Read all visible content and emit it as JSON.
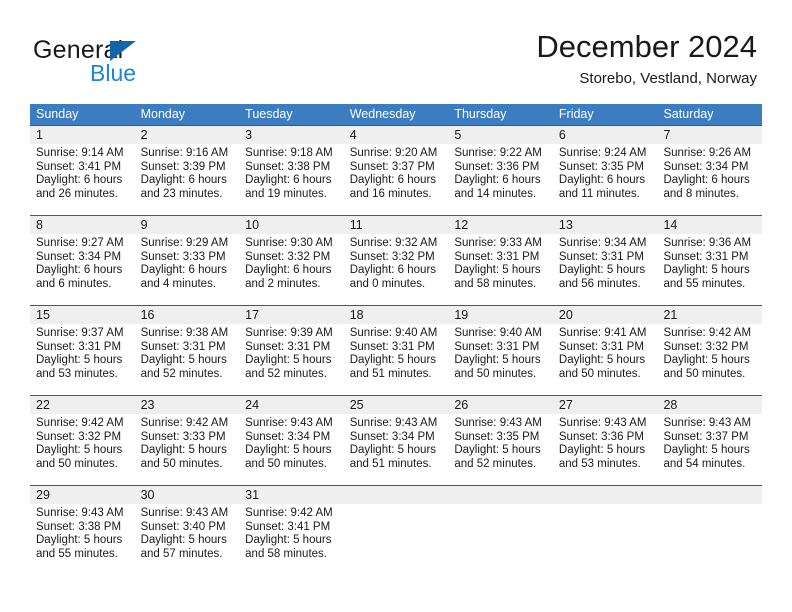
{
  "brand": {
    "name_part1": "General",
    "name_part2": "Blue",
    "logo_icon": "triangle-icon",
    "accent_color": "#1d86d8",
    "triangle_color": "#1165ad"
  },
  "header": {
    "month_title": "December 2024",
    "location": "Storebo, Vestland, Norway"
  },
  "theme": {
    "header_row_color": "#3b7dc0",
    "date_band_color": "#efefef",
    "week_divider_color": "#1f5fa8"
  },
  "weekdays": [
    "Sunday",
    "Monday",
    "Tuesday",
    "Wednesday",
    "Thursday",
    "Friday",
    "Saturday"
  ],
  "weeks": [
    {
      "days": [
        {
          "num": "1",
          "sunrise": "Sunrise: 9:14 AM",
          "sunset": "Sunset: 3:41 PM",
          "daylight1": "Daylight: 6 hours",
          "daylight2": "and 26 minutes."
        },
        {
          "num": "2",
          "sunrise": "Sunrise: 9:16 AM",
          "sunset": "Sunset: 3:39 PM",
          "daylight1": "Daylight: 6 hours",
          "daylight2": "and 23 minutes."
        },
        {
          "num": "3",
          "sunrise": "Sunrise: 9:18 AM",
          "sunset": "Sunset: 3:38 PM",
          "daylight1": "Daylight: 6 hours",
          "daylight2": "and 19 minutes."
        },
        {
          "num": "4",
          "sunrise": "Sunrise: 9:20 AM",
          "sunset": "Sunset: 3:37 PM",
          "daylight1": "Daylight: 6 hours",
          "daylight2": "and 16 minutes."
        },
        {
          "num": "5",
          "sunrise": "Sunrise: 9:22 AM",
          "sunset": "Sunset: 3:36 PM",
          "daylight1": "Daylight: 6 hours",
          "daylight2": "and 14 minutes."
        },
        {
          "num": "6",
          "sunrise": "Sunrise: 9:24 AM",
          "sunset": "Sunset: 3:35 PM",
          "daylight1": "Daylight: 6 hours",
          "daylight2": "and 11 minutes."
        },
        {
          "num": "7",
          "sunrise": "Sunrise: 9:26 AM",
          "sunset": "Sunset: 3:34 PM",
          "daylight1": "Daylight: 6 hours",
          "daylight2": "and 8 minutes."
        }
      ]
    },
    {
      "days": [
        {
          "num": "8",
          "sunrise": "Sunrise: 9:27 AM",
          "sunset": "Sunset: 3:34 PM",
          "daylight1": "Daylight: 6 hours",
          "daylight2": "and 6 minutes."
        },
        {
          "num": "9",
          "sunrise": "Sunrise: 9:29 AM",
          "sunset": "Sunset: 3:33 PM",
          "daylight1": "Daylight: 6 hours",
          "daylight2": "and 4 minutes."
        },
        {
          "num": "10",
          "sunrise": "Sunrise: 9:30 AM",
          "sunset": "Sunset: 3:32 PM",
          "daylight1": "Daylight: 6 hours",
          "daylight2": "and 2 minutes."
        },
        {
          "num": "11",
          "sunrise": "Sunrise: 9:32 AM",
          "sunset": "Sunset: 3:32 PM",
          "daylight1": "Daylight: 6 hours",
          "daylight2": "and 0 minutes."
        },
        {
          "num": "12",
          "sunrise": "Sunrise: 9:33 AM",
          "sunset": "Sunset: 3:31 PM",
          "daylight1": "Daylight: 5 hours",
          "daylight2": "and 58 minutes."
        },
        {
          "num": "13",
          "sunrise": "Sunrise: 9:34 AM",
          "sunset": "Sunset: 3:31 PM",
          "daylight1": "Daylight: 5 hours",
          "daylight2": "and 56 minutes."
        },
        {
          "num": "14",
          "sunrise": "Sunrise: 9:36 AM",
          "sunset": "Sunset: 3:31 PM",
          "daylight1": "Daylight: 5 hours",
          "daylight2": "and 55 minutes."
        }
      ]
    },
    {
      "days": [
        {
          "num": "15",
          "sunrise": "Sunrise: 9:37 AM",
          "sunset": "Sunset: 3:31 PM",
          "daylight1": "Daylight: 5 hours",
          "daylight2": "and 53 minutes."
        },
        {
          "num": "16",
          "sunrise": "Sunrise: 9:38 AM",
          "sunset": "Sunset: 3:31 PM",
          "daylight1": "Daylight: 5 hours",
          "daylight2": "and 52 minutes."
        },
        {
          "num": "17",
          "sunrise": "Sunrise: 9:39 AM",
          "sunset": "Sunset: 3:31 PM",
          "daylight1": "Daylight: 5 hours",
          "daylight2": "and 52 minutes."
        },
        {
          "num": "18",
          "sunrise": "Sunrise: 9:40 AM",
          "sunset": "Sunset: 3:31 PM",
          "daylight1": "Daylight: 5 hours",
          "daylight2": "and 51 minutes."
        },
        {
          "num": "19",
          "sunrise": "Sunrise: 9:40 AM",
          "sunset": "Sunset: 3:31 PM",
          "daylight1": "Daylight: 5 hours",
          "daylight2": "and 50 minutes."
        },
        {
          "num": "20",
          "sunrise": "Sunrise: 9:41 AM",
          "sunset": "Sunset: 3:31 PM",
          "daylight1": "Daylight: 5 hours",
          "daylight2": "and 50 minutes."
        },
        {
          "num": "21",
          "sunrise": "Sunrise: 9:42 AM",
          "sunset": "Sunset: 3:32 PM",
          "daylight1": "Daylight: 5 hours",
          "daylight2": "and 50 minutes."
        }
      ]
    },
    {
      "days": [
        {
          "num": "22",
          "sunrise": "Sunrise: 9:42 AM",
          "sunset": "Sunset: 3:32 PM",
          "daylight1": "Daylight: 5 hours",
          "daylight2": "and 50 minutes."
        },
        {
          "num": "23",
          "sunrise": "Sunrise: 9:42 AM",
          "sunset": "Sunset: 3:33 PM",
          "daylight1": "Daylight: 5 hours",
          "daylight2": "and 50 minutes."
        },
        {
          "num": "24",
          "sunrise": "Sunrise: 9:43 AM",
          "sunset": "Sunset: 3:34 PM",
          "daylight1": "Daylight: 5 hours",
          "daylight2": "and 50 minutes."
        },
        {
          "num": "25",
          "sunrise": "Sunrise: 9:43 AM",
          "sunset": "Sunset: 3:34 PM",
          "daylight1": "Daylight: 5 hours",
          "daylight2": "and 51 minutes."
        },
        {
          "num": "26",
          "sunrise": "Sunrise: 9:43 AM",
          "sunset": "Sunset: 3:35 PM",
          "daylight1": "Daylight: 5 hours",
          "daylight2": "and 52 minutes."
        },
        {
          "num": "27",
          "sunrise": "Sunrise: 9:43 AM",
          "sunset": "Sunset: 3:36 PM",
          "daylight1": "Daylight: 5 hours",
          "daylight2": "and 53 minutes."
        },
        {
          "num": "28",
          "sunrise": "Sunrise: 9:43 AM",
          "sunset": "Sunset: 3:37 PM",
          "daylight1": "Daylight: 5 hours",
          "daylight2": "and 54 minutes."
        }
      ]
    },
    {
      "days": [
        {
          "num": "29",
          "sunrise": "Sunrise: 9:43 AM",
          "sunset": "Sunset: 3:38 PM",
          "daylight1": "Daylight: 5 hours",
          "daylight2": "and 55 minutes."
        },
        {
          "num": "30",
          "sunrise": "Sunrise: 9:43 AM",
          "sunset": "Sunset: 3:40 PM",
          "daylight1": "Daylight: 5 hours",
          "daylight2": "and 57 minutes."
        },
        {
          "num": "31",
          "sunrise": "Sunrise: 9:42 AM",
          "sunset": "Sunset: 3:41 PM",
          "daylight1": "Daylight: 5 hours",
          "daylight2": "and 58 minutes."
        },
        {
          "num": "",
          "sunrise": "",
          "sunset": "",
          "daylight1": "",
          "daylight2": ""
        },
        {
          "num": "",
          "sunrise": "",
          "sunset": "",
          "daylight1": "",
          "daylight2": ""
        },
        {
          "num": "",
          "sunrise": "",
          "sunset": "",
          "daylight1": "",
          "daylight2": ""
        },
        {
          "num": "",
          "sunrise": "",
          "sunset": "",
          "daylight1": "",
          "daylight2": ""
        }
      ]
    }
  ]
}
